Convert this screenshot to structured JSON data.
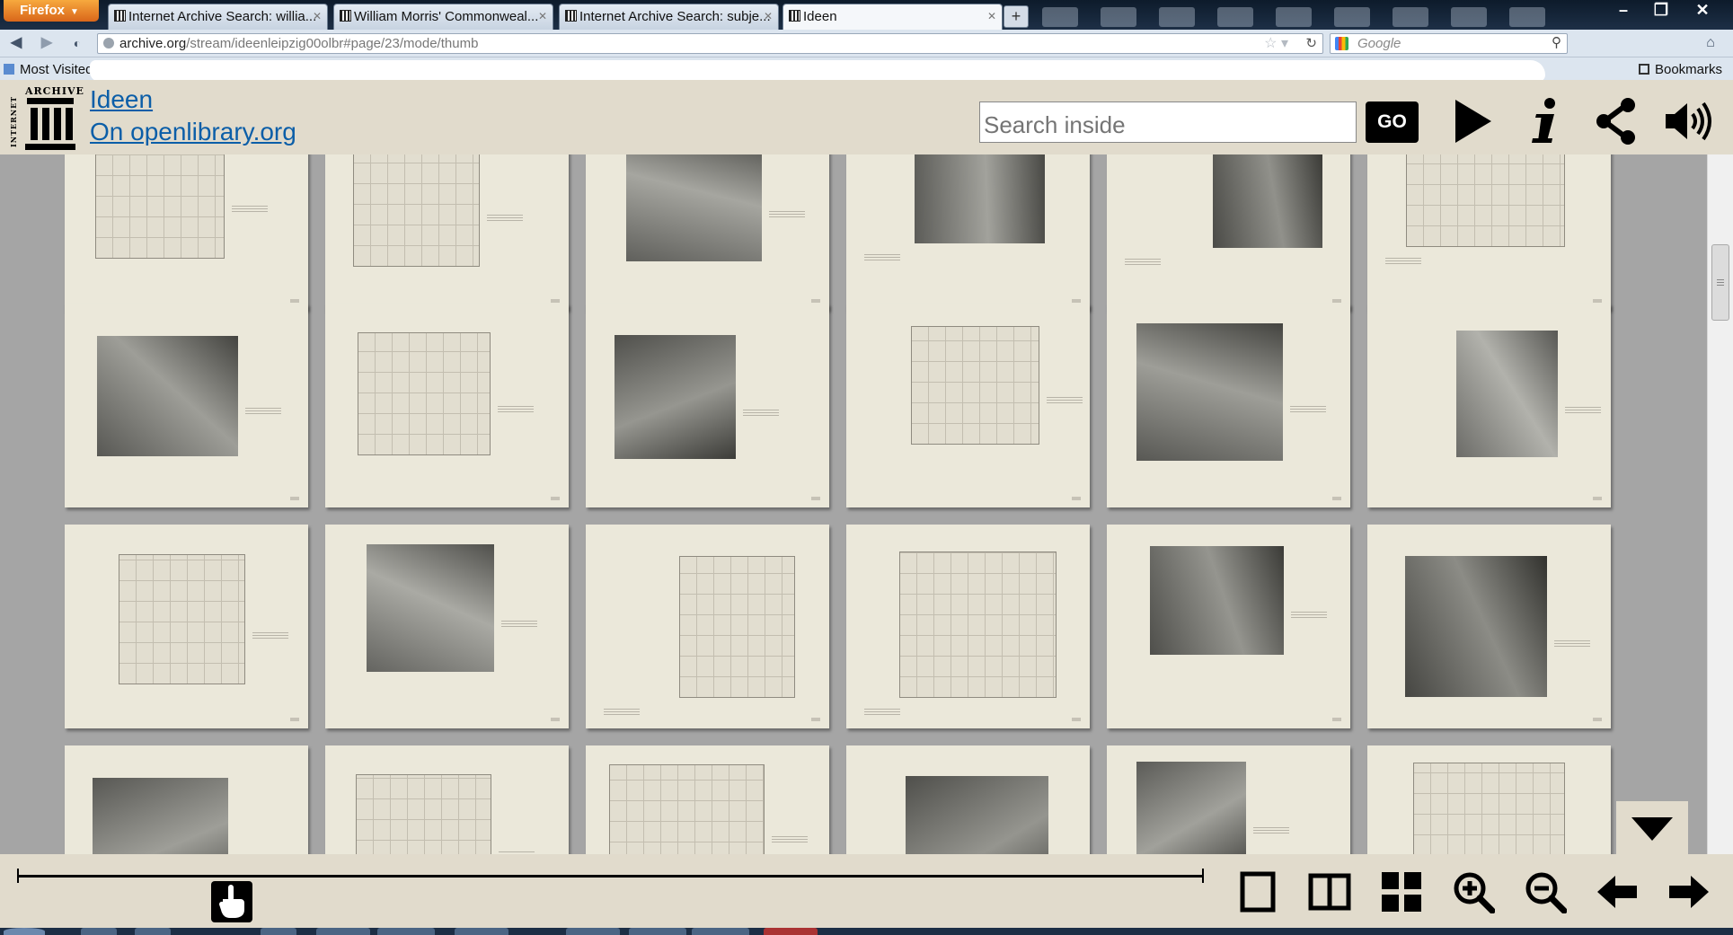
{
  "browser": {
    "app_button": "Firefox",
    "tabs": [
      {
        "title": "Internet Archive Search: willia...",
        "active": false
      },
      {
        "title": "William Morris' Commonweal...",
        "active": false
      },
      {
        "title": "Internet Archive Search: subje...",
        "active": false
      },
      {
        "title": "Ideen",
        "active": true
      }
    ],
    "new_tab": "+",
    "url_host": "archive.org",
    "url_path": "/stream/ideenleipzig00olbr#page/23/mode/thumb",
    "search_engine_placeholder": "Google",
    "bookmarks_left": "Most Visited",
    "bookmarks_right": "Bookmarks",
    "window_controls": [
      "–",
      "❐",
      "✕"
    ]
  },
  "header": {
    "logo_top": "ARCHIVE",
    "logo_side": "INTERNET",
    "title": "Ideen",
    "subtitle": "On openlibrary.org",
    "search_placeholder": "Search inside",
    "go_label": "GO",
    "icons": [
      "play-icon",
      "info-icon",
      "share-icon",
      "audio-icon"
    ]
  },
  "bottom_nav": {
    "slider_position": 0.18,
    "icons": [
      "one-page-icon",
      "two-page-icon",
      "thumbnail-grid-icon",
      "zoom-in-icon",
      "zoom-out-icon",
      "previous-page-icon",
      "next-page-icon"
    ]
  },
  "grid": {
    "columns": 6,
    "rows": 4,
    "page_style": [
      "sketch",
      "sketch",
      "photo",
      "photo",
      "photo",
      "sketch",
      "photo",
      "sketch",
      "photo",
      "sketch",
      "photo",
      "photo",
      "sketch",
      "photo",
      "sketch",
      "sketch",
      "photo",
      "photo",
      "photo",
      "sketch",
      "sketch",
      "photo",
      "photo",
      "sketch"
    ]
  },
  "colors": {
    "panel_bg": "#e1dbcc",
    "link": "#0b5ea8",
    "grid_bg": "#a5a5a5",
    "page_bg": "#ebe8da"
  }
}
